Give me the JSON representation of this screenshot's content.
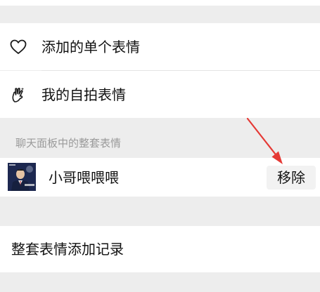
{
  "menu": {
    "single_sticker_label": "添加的单个表情",
    "selfie_sticker_label": "我的自拍表情"
  },
  "section": {
    "title": "聊天面板中的整套表情"
  },
  "sticker_pack": {
    "name": "小哥喂喂喂",
    "remove_label": "移除"
  },
  "history": {
    "label": "整套表情添加记录"
  },
  "colors": {
    "background": "#ededed",
    "row": "#ffffff",
    "arrow": "#e53935",
    "section_text": "#9a9a9a"
  },
  "icons": {
    "single": "heart-outline-icon",
    "selfie": "selfie-hand-icon",
    "annotation": "red-arrow-annotation"
  }
}
